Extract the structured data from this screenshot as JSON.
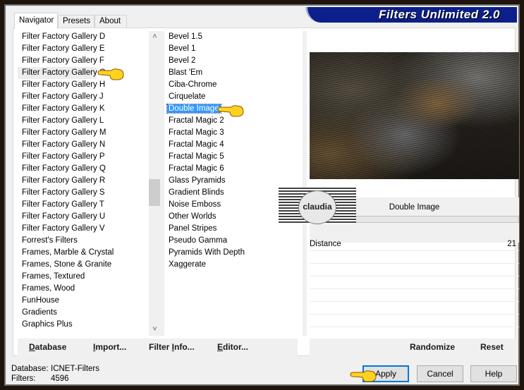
{
  "window": {
    "title": "Filters Unlimited 2.0",
    "accent_color": "#0c1f8a"
  },
  "tabs": [
    {
      "label": "Navigator",
      "active": true
    },
    {
      "label": "Presets",
      "active": false
    },
    {
      "label": "About",
      "active": false
    }
  ],
  "categories": {
    "items": [
      "Filter Factory Gallery D",
      "Filter Factory Gallery E",
      "Filter Factory Gallery F",
      "Filter Factory Gallery G",
      "Filter Factory Gallery H",
      "Filter Factory Gallery J",
      "Filter Factory Gallery K",
      "Filter Factory Gallery L",
      "Filter Factory Gallery M",
      "Filter Factory Gallery N",
      "Filter Factory Gallery P",
      "Filter Factory Gallery Q",
      "Filter Factory Gallery R",
      "Filter Factory Gallery S",
      "Filter Factory Gallery T",
      "Filter Factory Gallery U",
      "Filter Factory Gallery V",
      "Forrest's Filters",
      "Frames, Marble & Crystal",
      "Frames, Stone & Granite",
      "Frames, Textured",
      "Frames, Wood",
      "FunHouse",
      "Gradients",
      "Graphics Plus"
    ],
    "selected": "Filter Factory Gallery G"
  },
  "filters": {
    "items": [
      "Bevel 1.5",
      "Bevel 1",
      "Bevel 2",
      "Blast 'Em",
      "Ciba-Chrome",
      "Cirquelate",
      "Double Image",
      "Fractal Magic 2",
      "Fractal Magic 3",
      "Fractal Magic 4",
      "Fractal Magic 5",
      "Fractal Magic 6",
      "Glass Pyramids",
      "Gradient Blinds",
      "Noise Emboss",
      "Other Worlds",
      "Panel Stripes",
      "Pseudo Gamma",
      "Pyramids With Depth",
      "Xaggerate"
    ],
    "selected": "Double Image",
    "selected_color": "#3399ff"
  },
  "parameters": {
    "filter_name": "Double Image",
    "rows": [
      {
        "label": "Distance",
        "value": "21"
      }
    ]
  },
  "watermark": {
    "text": "claudia"
  },
  "left_buttons": {
    "database": {
      "pre": "",
      "u": "D",
      "post": "atabase"
    },
    "import": {
      "pre": "",
      "u": "I",
      "post": "mport..."
    },
    "filter_info": {
      "pre": "Filter ",
      "u": "I",
      "post": "nfo..."
    },
    "editor": {
      "pre": "",
      "u": "E",
      "post": "ditor..."
    }
  },
  "right_buttons": {
    "randomize": "Randomize",
    "reset": "Reset"
  },
  "status": {
    "database_label": "Database:",
    "database_value": "ICNET-Filters",
    "filters_label": "Filters:",
    "filters_value": "4596"
  },
  "dialog_buttons": {
    "apply": "Apply",
    "cancel": "Cancel",
    "help": "Help"
  },
  "icons": {
    "pointer": "pointing-hand-icon",
    "scroll_up": "chevron-up-icon",
    "scroll_down": "chevron-down-icon"
  }
}
